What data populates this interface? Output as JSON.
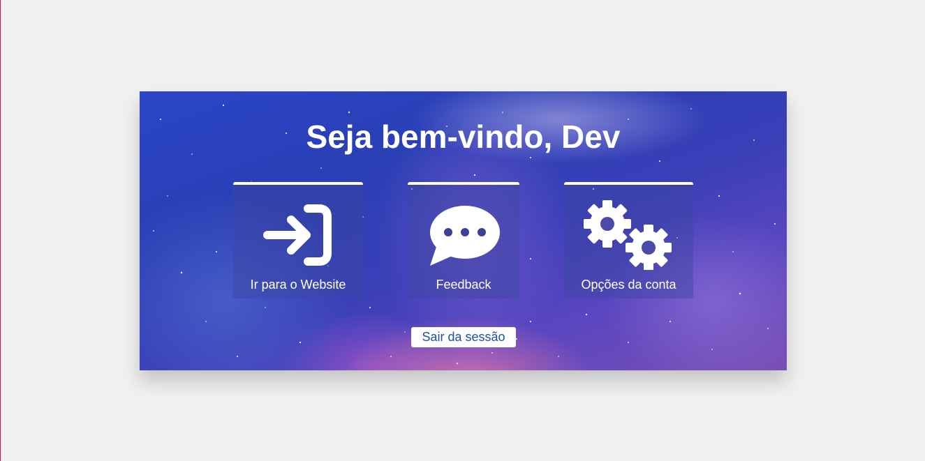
{
  "header": {
    "title": "Seja bem-vindo, Dev"
  },
  "cards": [
    {
      "label": "Ir para o Website",
      "icon": "login-arrow-icon"
    },
    {
      "label": "Feedback",
      "icon": "chat-bubble-icon"
    },
    {
      "label": "Opções da conta",
      "icon": "gears-icon"
    }
  ],
  "actions": {
    "logout_label": "Sair da sessão"
  },
  "colors": {
    "page_background": "#f0f0f0",
    "card_top_border": "#ffffff",
    "logout_text": "#1d4fa8",
    "edge_line": "#c8163a"
  }
}
